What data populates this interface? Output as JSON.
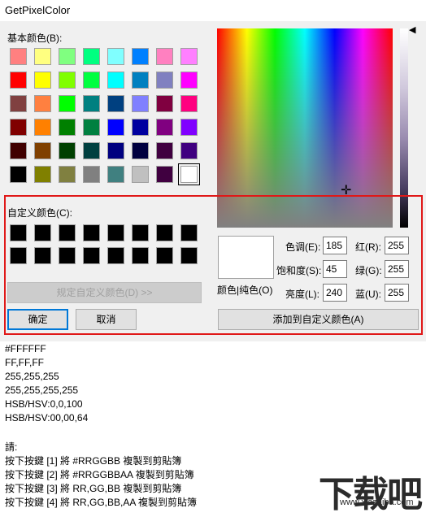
{
  "window": {
    "title": "GetPixelColor"
  },
  "dialog": {
    "basic_colors_label": "基本颜色(B):",
    "custom_colors_label": "自定义颜色(C):",
    "basic_colors": [
      [
        "#ff8080",
        "#ffff80",
        "#80ff80",
        "#00ff80",
        "#80ffff",
        "#0080ff",
        "#ff80c0",
        "#ff80ff"
      ],
      [
        "#ff0000",
        "#ffff00",
        "#80ff00",
        "#00ff40",
        "#00ffff",
        "#0080c0",
        "#8080c0",
        "#ff00ff"
      ],
      [
        "#804040",
        "#ff8040",
        "#00ff00",
        "#008080",
        "#004080",
        "#8080ff",
        "#800040",
        "#ff0080"
      ],
      [
        "#800000",
        "#ff8000",
        "#008000",
        "#008040",
        "#0000ff",
        "#0000a0",
        "#800080",
        "#8000ff"
      ],
      [
        "#400000",
        "#804000",
        "#004000",
        "#004040",
        "#000080",
        "#000040",
        "#400040",
        "#400080"
      ],
      [
        "#000000",
        "#808000",
        "#808040",
        "#808080",
        "#408080",
        "#c0c0c0",
        "#400040",
        "#ffffff"
      ]
    ],
    "selected_basic": "#ffffff",
    "custom_colors": [
      [
        "#000000",
        "#000000",
        "#000000",
        "#000000",
        "#000000",
        "#000000",
        "#000000",
        "#000000"
      ],
      [
        "#000000",
        "#000000",
        "#000000",
        "#000000",
        "#000000",
        "#000000",
        "#000000",
        "#000000"
      ]
    ],
    "define_custom_button": "规定自定义颜色(D) >>",
    "ok_button": "确定",
    "cancel_button": "取消",
    "add_custom_button": "添加到自定义颜色(A)",
    "color_solid_label": "颜色|纯色(O)",
    "hue_label": "色调(E):",
    "sat_label": "饱和度(S):",
    "lum_label": "亮度(L):",
    "red_label": "红(R):",
    "green_label": "绿(G):",
    "blue_label": "蓝(U):",
    "hue_value": "185",
    "sat_value": "45",
    "lum_value": "240",
    "red_value": "255",
    "green_value": "255",
    "blue_value": "255",
    "preview_color": "#ffffff"
  },
  "output": {
    "lines": [
      "#FFFFFF",
      "FF,FF,FF",
      "255,255,255",
      "255,255,255,255",
      "HSB/HSV:0,0,100",
      "HSB/HSV:00,00,64",
      "",
      "請:",
      "按下按鍵 [1] 將 #RRGGBB 複製到剪貼簿",
      "按下按鍵 [2] 將 #RRGGBBAA 複製到剪貼簿",
      "按下按鍵 [3] 將 RR,GG,BB 複製到剪貼簿",
      "按下按鍵 [4] 將 RR,GG,BB,AA 複製到剪貼簿"
    ]
  },
  "watermark": {
    "text": "下载吧",
    "url": "www.xiazaiba.com"
  }
}
